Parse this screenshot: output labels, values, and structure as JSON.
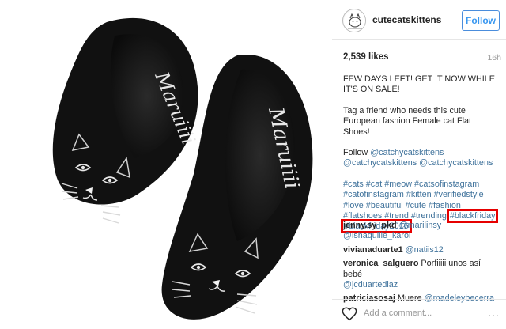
{
  "post": {
    "username": "cutecatskittens",
    "follow_label": "Follow",
    "likes": "2,539 likes",
    "time": "16h",
    "caption": {
      "line1": "FEW DAYS LEFT! GET IT NOW WHILE IT'S ON SALE!",
      "line2": "Tag a friend who needs this cute European fashion Female cat Flat Shoes!",
      "follow_prefix": "Follow ",
      "mention1": "@catchycatskittens",
      "mention2": "@catchycatskittens",
      "mention3": "@catchycatskittens",
      "tags_plain": "#cats #cat #meow #catsofinstagram #catofinstagram #kitten #verifiedstyle #love #beautiful #cute #fashion #flatshoes #trend #trending",
      "tag_boxed_1": "#blackfriday",
      "tag_boxed_2": "#blackfriday2016"
    },
    "comments": [
      {
        "user": "jenny.sy_pkd",
        "mention": "@marilinsy",
        "mention2": "@ishaquille_karol",
        "text": ""
      },
      {
        "user": "vivianaduarte1",
        "mention": "@natiis12",
        "text": ""
      },
      {
        "user": "veronica_salguero",
        "text": "Porfiiiii unos así bebé",
        "mention": "@jcduartediaz"
      },
      {
        "user": "patriciasosaj",
        "text": "Muere",
        "mention": "@madeleybecerra"
      }
    ],
    "add_comment_placeholder": "Add a comment...",
    "more_label": "...",
    "shoe_brand": "Maruiiii"
  },
  "colors": {
    "link": "#3f729b",
    "follow_blue": "#3897f0",
    "highlight_red": "#e60000"
  }
}
